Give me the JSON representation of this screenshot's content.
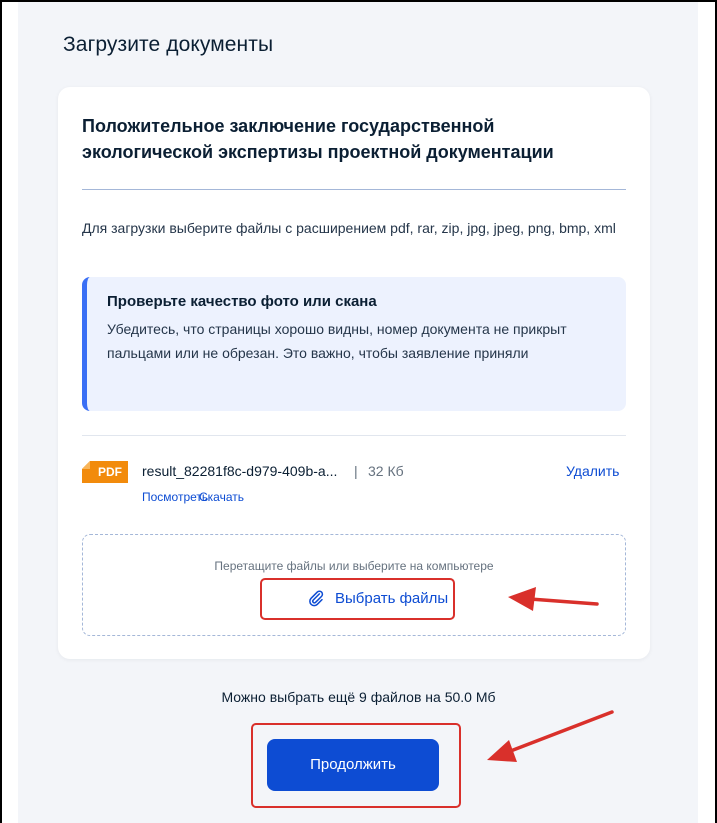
{
  "page": {
    "title": "Загрузите документы"
  },
  "card": {
    "title": "Положительное заключение государственной экологической экспертизы проектной документации",
    "hint": "Для загрузки выберите файлы с расширением pdf, rar, zip, jpg, jpeg, png, bmp, xml",
    "notice": {
      "title": "Проверьте качество фото или скана",
      "text": "Убедитесь, что страницы хорошо видны, номер документа не прикрыт пальцами или не обрезан. Это важно, чтобы заявление приняли"
    },
    "file": {
      "badge": "PDF",
      "name": "result_82281f8c-d979-409b-a...",
      "separator": "|",
      "size": "32 Кб",
      "view_label": "Посмотреть",
      "download_label": "Скачать",
      "delete_label": "Удалить"
    },
    "dropzone": {
      "text": "Перетащите файлы или выберите на компьютере",
      "button_label": "Выбрать файлы"
    }
  },
  "remaining": "Можно выбрать ещё 9 файлов на 50.0 Мб",
  "continue_label": "Продолжить",
  "icons": [
    "paperclip-icon",
    "pdf-file-icon"
  ],
  "colors": {
    "accent": "#0d4cd3",
    "badge": "#f28b0c",
    "annotation": "#d9302b"
  }
}
